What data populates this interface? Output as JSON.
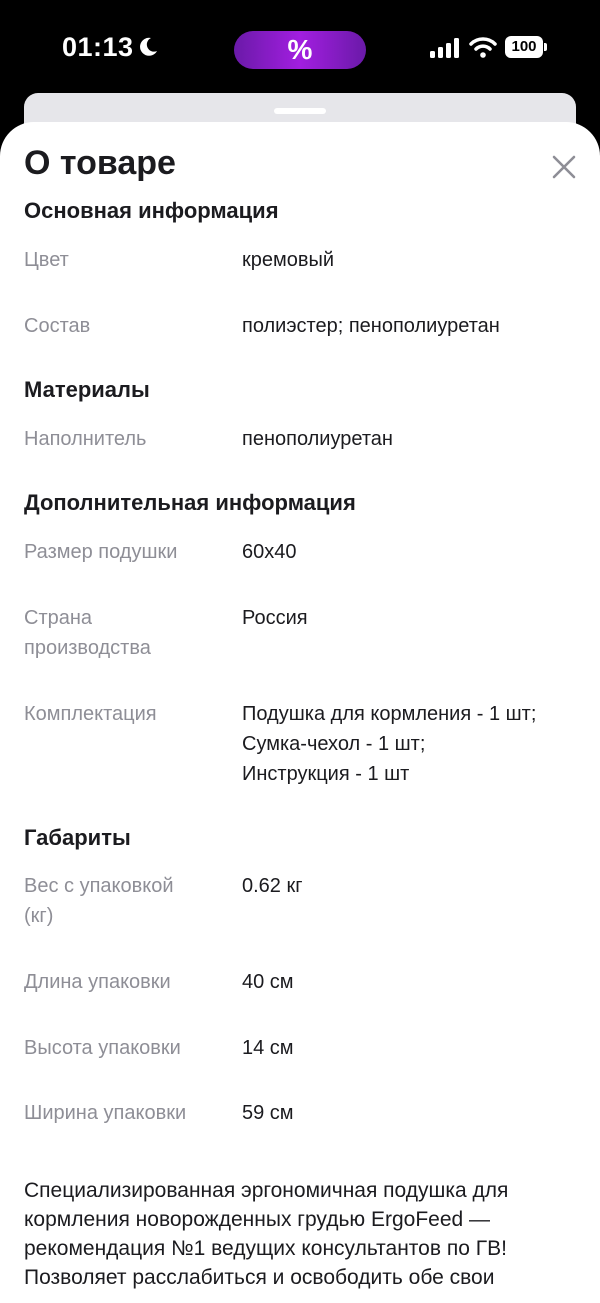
{
  "status_bar": {
    "time": "01:13",
    "island_text": "%",
    "battery": "100"
  },
  "sheet": {
    "title": "О товаре"
  },
  "sections": {
    "basic": {
      "title": "Основная информация",
      "color_label": "Цвет",
      "color_value": "кремовый",
      "composition_label": "Состав",
      "composition_value": "полиэстер; пенополиуретан"
    },
    "materials": {
      "title": "Материалы",
      "filler_label": "Наполнитель",
      "filler_value": "пенополиуретан"
    },
    "additional": {
      "title": "Дополнительная информация",
      "size_label": "Размер подушки",
      "size_value": "60х40",
      "country_label_1": "Страна",
      "country_label_2": "производства",
      "country_value": "Россия",
      "kit_label": "Комплектация",
      "kit_value_1": "Подушка для кормления - 1 шт;",
      "kit_value_2": "Сумка-чехол - 1 шт;",
      "kit_value_3": "Инструкция - 1 шт"
    },
    "dimensions": {
      "title": "Габариты",
      "weight_label_1": "Вес с упаковкой",
      "weight_label_2": "(кг)",
      "weight_value": "0.62 кг",
      "length_label": "Длина упаковки",
      "length_value": "40 см",
      "height_label": "Высота упаковки",
      "height_value": "14 см",
      "width_label": "Ширина упаковки",
      "width_value": "59 см"
    }
  },
  "description": {
    "line_1": "Специализированная эргономичная подушка для",
    "line_2": "кормления новорожденных грудью ErgoFeed —",
    "line_3": "рекомендация №1 ведущих консультантов по ГВ!",
    "line_4": "Позволяет расслабиться и освободить обе свои"
  },
  "icons": {
    "close": "close-icon",
    "moon": "moon-icon",
    "signal": "signal-icon",
    "wifi": "wifi-icon"
  }
}
